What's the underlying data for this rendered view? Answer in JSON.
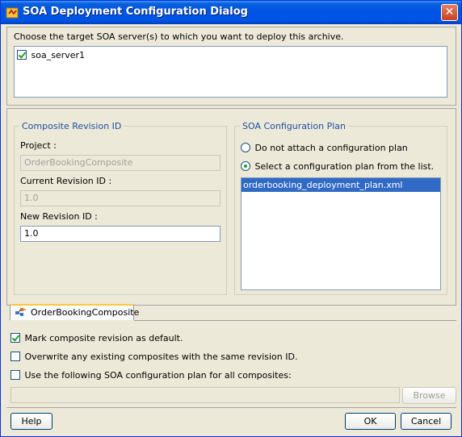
{
  "window": {
    "title": "SOA Deployment Configuration Dialog",
    "close_label": "✕"
  },
  "server_section": {
    "prompt": "Choose the target SOA server(s) to which you want to deploy this archive.",
    "servers": [
      {
        "name": "soa_server1",
        "checked": true
      }
    ]
  },
  "composite_revision": {
    "group_title": "Composite Revision ID",
    "project_label": "Project :",
    "project_value": "OrderBookingComposite",
    "current_revision_label": "Current Revision ID :",
    "current_revision_value": "1.0",
    "new_revision_label": "New Revision ID :",
    "new_revision_value": "1.0"
  },
  "config_plan": {
    "group_title": "SOA Configuration Plan",
    "option_none": "Do not attach a configuration plan",
    "option_select": "Select a configuration plan from the list.",
    "selected_option": "select",
    "plans": [
      "orderbooking_deployment_plan.xml"
    ],
    "selected_plan": "orderbooking_deployment_plan.xml"
  },
  "tabs": [
    {
      "label": "OrderBookingComposite",
      "active": true
    }
  ],
  "options": {
    "mark_default_label": "Mark composite revision as default.",
    "mark_default_checked": true,
    "overwrite_label": "Overwrite any existing composites with the same revision ID.",
    "overwrite_checked": false,
    "use_plan_label": "Use the following SOA configuration plan for all composites:",
    "use_plan_checked": false,
    "plan_path_value": "",
    "browse_label": "Browse"
  },
  "buttons": {
    "help": "Help",
    "ok": "OK",
    "cancel": "Cancel"
  }
}
